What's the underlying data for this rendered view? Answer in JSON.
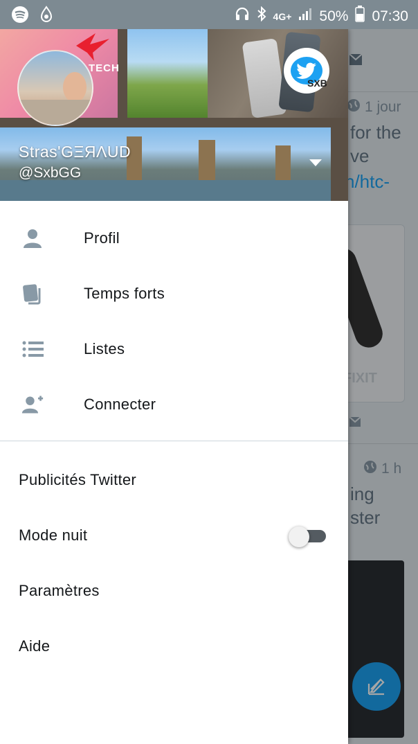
{
  "status_bar": {
    "network": "4G+",
    "battery_percent": "50%",
    "time": "07:30",
    "icons": [
      "spotify-icon",
      "app-notification-icon",
      "headphones-icon",
      "bluetooth-icon",
      "signal-icon",
      "battery-icon"
    ]
  },
  "profile": {
    "name": "Stras'GΞЯΛUD",
    "handle": "@SxbGG",
    "badge_text": "SXB",
    "header_tag": "TECH"
  },
  "menu": {
    "items": [
      {
        "label": "Profil",
        "icon": "person-icon"
      },
      {
        "label": "Temps forts",
        "icon": "moments-icon"
      },
      {
        "label": "Listes",
        "icon": "lists-icon"
      },
      {
        "label": "Connecter",
        "icon": "add-person-icon"
      }
    ],
    "secondary": [
      {
        "label": "Publicités Twitter"
      },
      {
        "label": "Mode nuit",
        "toggle": false
      },
      {
        "label": "Paramètres"
      },
      {
        "label": "Aide"
      }
    ]
  },
  "background": {
    "tweet1_time": "1 jour",
    "tweet1_line1": "for the",
    "tweet1_line2": "ve",
    "tweet1_link": "n/htc-",
    "card_watermark": "FIXIT",
    "tweet2_time": "1 h",
    "tweet2_line1": "ing",
    "tweet2_line2": "ster"
  },
  "colors": {
    "accent": "#1da1f2",
    "icon": "#8899a6",
    "text": "#14171a",
    "status_bar": "#7d8a92"
  }
}
